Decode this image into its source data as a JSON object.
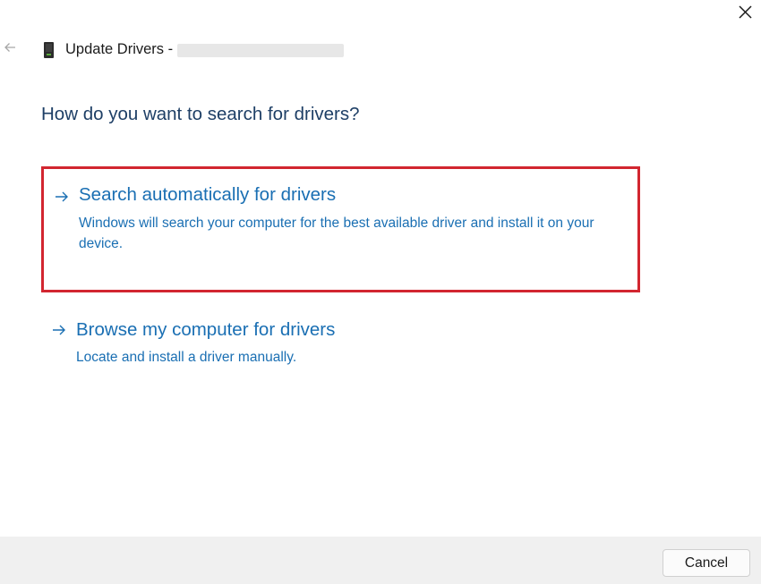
{
  "window": {
    "title": "Update Drivers -",
    "close_icon": "close-icon",
    "back_icon": "back-arrow-icon",
    "device_icon": "device-icon"
  },
  "main": {
    "question": "How do you want to search for drivers?",
    "options": [
      {
        "title": "Search automatically for drivers",
        "description": "Windows will search your computer for the best available driver and install it on your device.",
        "icon": "arrow-right-icon",
        "highlighted": true,
        "highlight_color": "#d22630"
      },
      {
        "title": "Browse my computer for drivers",
        "description": "Locate and install a driver manually.",
        "icon": "arrow-right-icon",
        "highlighted": false
      }
    ]
  },
  "footer": {
    "cancel_label": "Cancel"
  },
  "colors": {
    "link": "#1a6fb3",
    "heading": "#1e3f66",
    "highlight_border": "#d22630",
    "footer_bg": "#f0f0f0"
  }
}
